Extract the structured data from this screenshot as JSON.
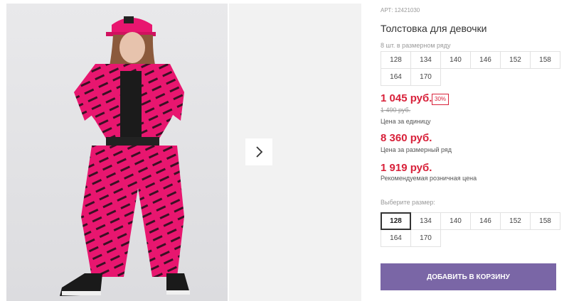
{
  "product": {
    "article": "АРТ: 12421030",
    "title": "Толстовка для девочки"
  },
  "pack": {
    "label": "8 шт. в размерном ряду",
    "sizes": [
      "128",
      "134",
      "140",
      "146",
      "152",
      "158",
      "164",
      "170"
    ]
  },
  "pricing": {
    "unit_price": "1 045 руб.",
    "discount": "30%",
    "old_price": "1 490 руб.",
    "unit_label": "Цена за единицу",
    "pack_price": "8 360 руб.",
    "pack_label": "Цена за размерный ряд",
    "retail_price": "1 919 руб.",
    "retail_label": "Рекомендуемая розничная цена"
  },
  "size_select": {
    "label": "Выберите размер:",
    "options": [
      "128",
      "134",
      "140",
      "146",
      "152",
      "158",
      "164",
      "170"
    ],
    "selected": "128"
  },
  "cart": {
    "button_label": "ДОБАВИТЬ В КОРЗИНУ"
  },
  "colors": {
    "accent": "#7a66a6",
    "price_red": "#d8213a"
  }
}
